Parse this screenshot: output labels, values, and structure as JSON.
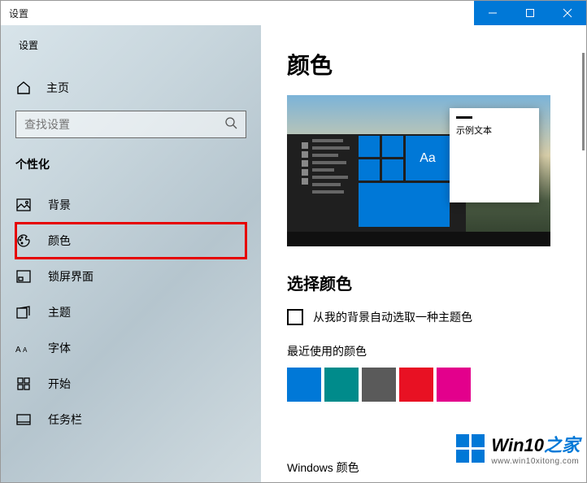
{
  "titlebar": {
    "label": "设置"
  },
  "sidebar": {
    "settings_label": "设置",
    "home_label": "主页",
    "search_placeholder": "查找设置",
    "category_label": "个性化",
    "items": [
      {
        "label": "背景"
      },
      {
        "label": "颜色"
      },
      {
        "label": "锁屏界面"
      },
      {
        "label": "主题"
      },
      {
        "label": "字体"
      },
      {
        "label": "开始"
      },
      {
        "label": "任务栏"
      }
    ]
  },
  "main": {
    "title": "颜色",
    "preview_sample_text": "示例文本",
    "preview_aa": "Aa",
    "choose_color_header": "选择颜色",
    "auto_pick_label": "从我的背景自动选取一种主题色",
    "recent_colors_label": "最近使用的颜色",
    "recent_colors": [
      "#0078d7",
      "#008b8b",
      "#5a5a5a",
      "#e81123",
      "#e3008c"
    ],
    "windows_colors_label": "Windows 颜色"
  },
  "watermark": {
    "line1_a": "Win10",
    "line1_b": "之家",
    "line2": "www.win10xitong.com"
  }
}
